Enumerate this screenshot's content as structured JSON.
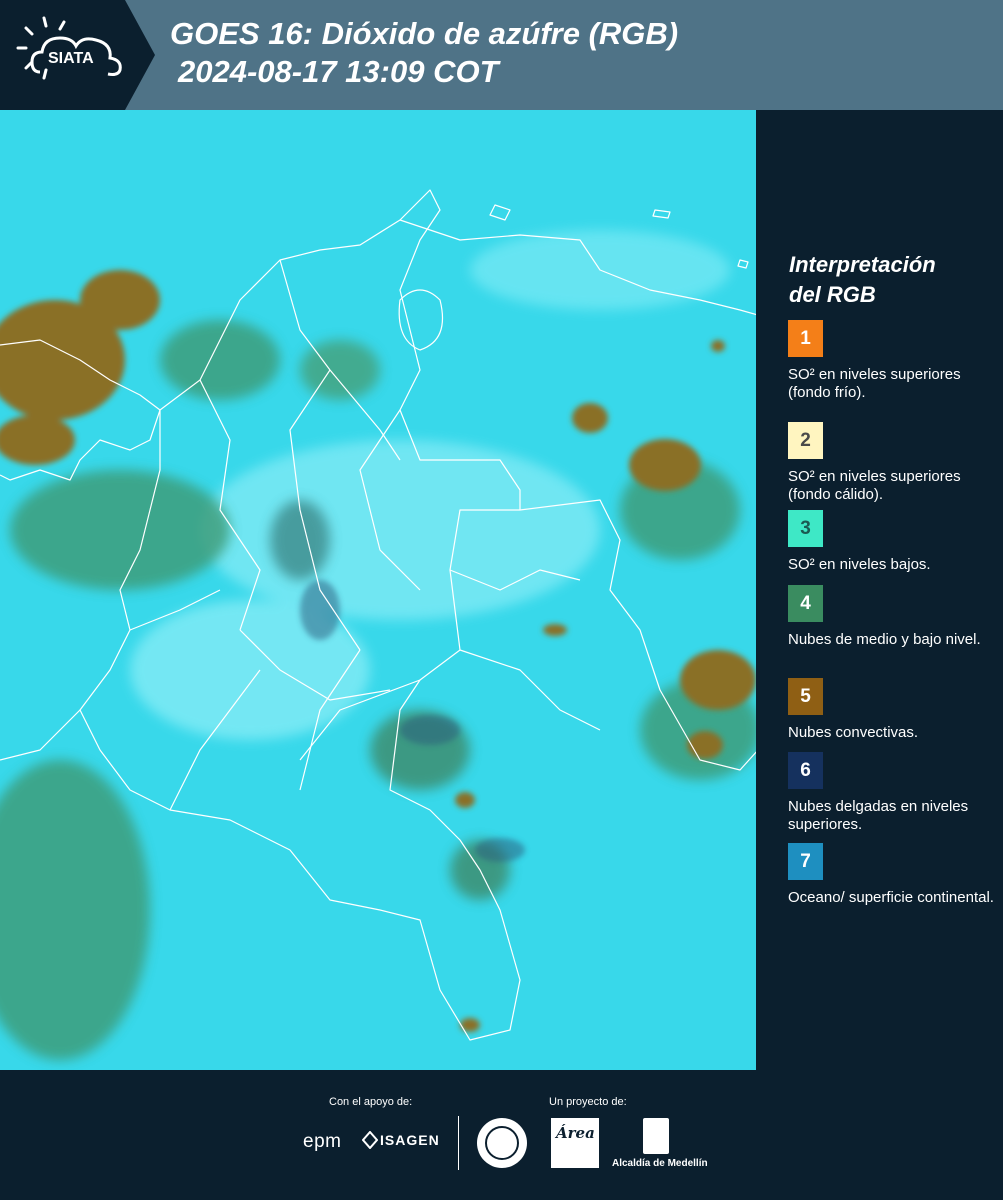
{
  "header": {
    "logo_text": "SIATA",
    "title": "GOES 16: Dióxido de azúfre (RGB)",
    "datetime": "2024-08-17 13:09 COT"
  },
  "map": {
    "base_color": "#38d8ea",
    "cloud_mid_color": "#3d9a74",
    "convective_color": "#8a7028",
    "border_color": "#ffffff"
  },
  "legend": {
    "title_line1": "Interpretación",
    "title_line2": "del RGB",
    "items": [
      {
        "number": "1",
        "color": "#f47f18",
        "text_color": "#ffffff",
        "label": "SO² en niveles superiores (fondo frío)."
      },
      {
        "number": "2",
        "color": "#fff5c0",
        "text_color": "#4a4a4a",
        "label": "SO² en niveles superiores (fondo cálido)."
      },
      {
        "number": "3",
        "color": "#3ee8c6",
        "text_color": "#1b5a52",
        "label": "SO² en niveles bajos."
      },
      {
        "number": "4",
        "color": "#3a8c60",
        "text_color": "#ffffff",
        "label": "Nubes de medio y bajo nivel."
      },
      {
        "number": "5",
        "color": "#8f5f14",
        "text_color": "#ffffff",
        "label": "Nubes convectivas."
      },
      {
        "number": "6",
        "color": "#15315e",
        "text_color": "#ffffff",
        "label": "Nubes delgadas en niveles superiores."
      },
      {
        "number": "7",
        "color": "#1e8fc0",
        "text_color": "#ffffff",
        "label": "Oceano/ superficie continental."
      }
    ]
  },
  "footer": {
    "support_label": "Con el apoyo de:",
    "project_label": "Un proyecto de:",
    "sponsor1": "epm",
    "sponsor2": "ISAGEN",
    "partner_area": "Área",
    "partner_alcaldia": "Alcaldía de Medellín"
  }
}
